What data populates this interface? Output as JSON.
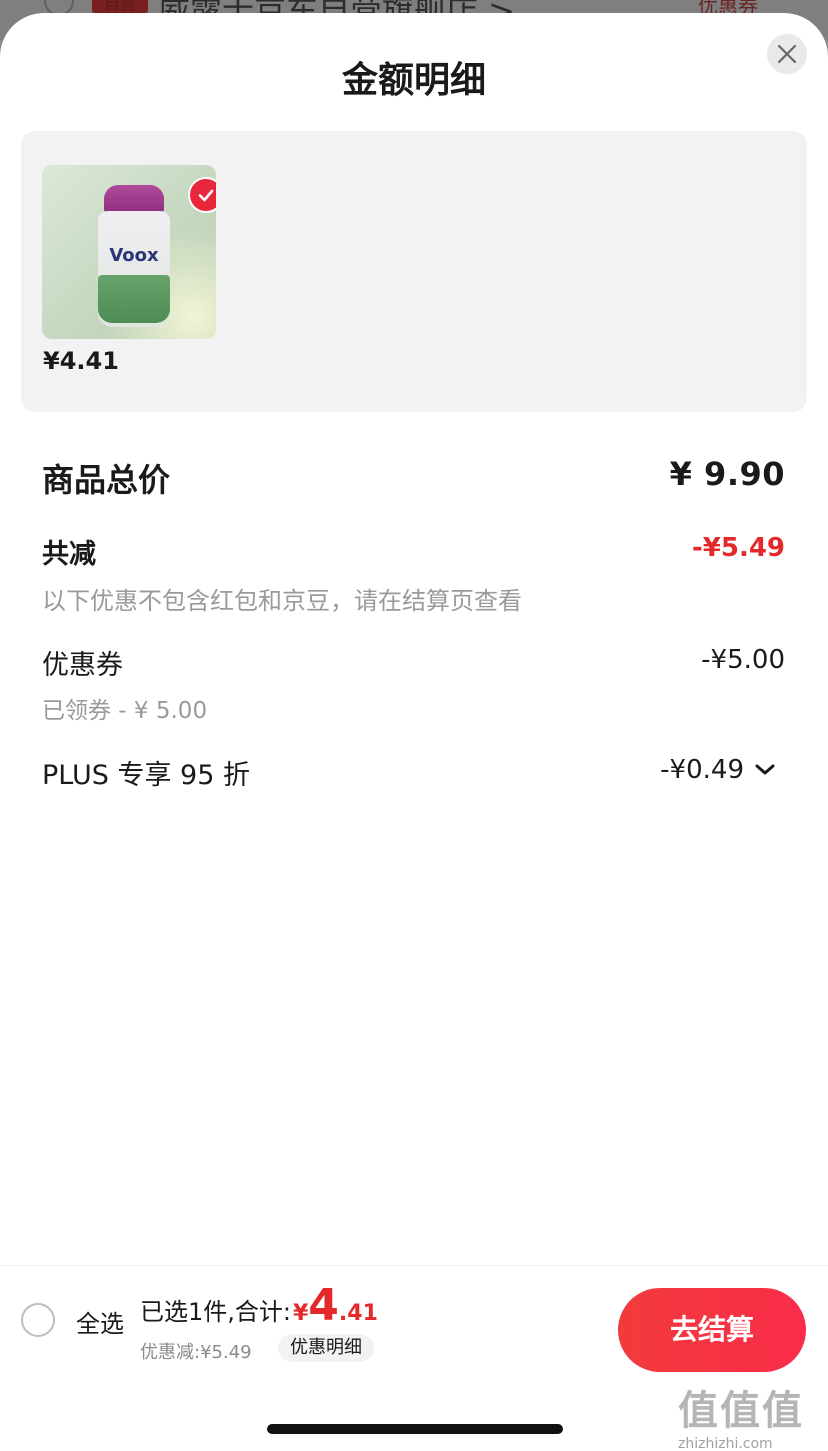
{
  "backdrop": {
    "tag": "自营",
    "store_name": "威露士京东自营旗舰店 >",
    "coupon_text": "优惠券"
  },
  "sheet": {
    "title": "金额明细",
    "close_icon": "close-icon"
  },
  "product": {
    "image_brand_text": "Voox",
    "price": "¥4.41",
    "selected": true
  },
  "breakdown": {
    "total_label": "商品总价",
    "total_value": "¥ 9.90",
    "reduce_label": "共减",
    "reduce_value": "-¥5.49",
    "reduce_note": "以下优惠不包含红包和京豆，请在结算页查看",
    "coupon_label": "优惠券",
    "coupon_value": "-¥5.00",
    "coupon_note": "已领券 - ¥ 5.00",
    "plus_label": "PLUS 专享 95 折",
    "plus_value": "-¥0.49"
  },
  "footer": {
    "select_all_label": "全选",
    "summary_prefix": "已选1件,合计:",
    "summary_yen": "¥",
    "summary_int": "4",
    "summary_dec": ".41",
    "discount_text": "优惠减:¥5.49",
    "detail_button": "优惠明细",
    "checkout_button": "去结算"
  },
  "watermark": {
    "mark": "值值值",
    "url": "zhizhizhi.com"
  },
  "colors": {
    "accent_red": "#e4292b",
    "checkout_gradient_start": "#f23b3b",
    "checkout_gradient_end": "#fa2c4a"
  }
}
